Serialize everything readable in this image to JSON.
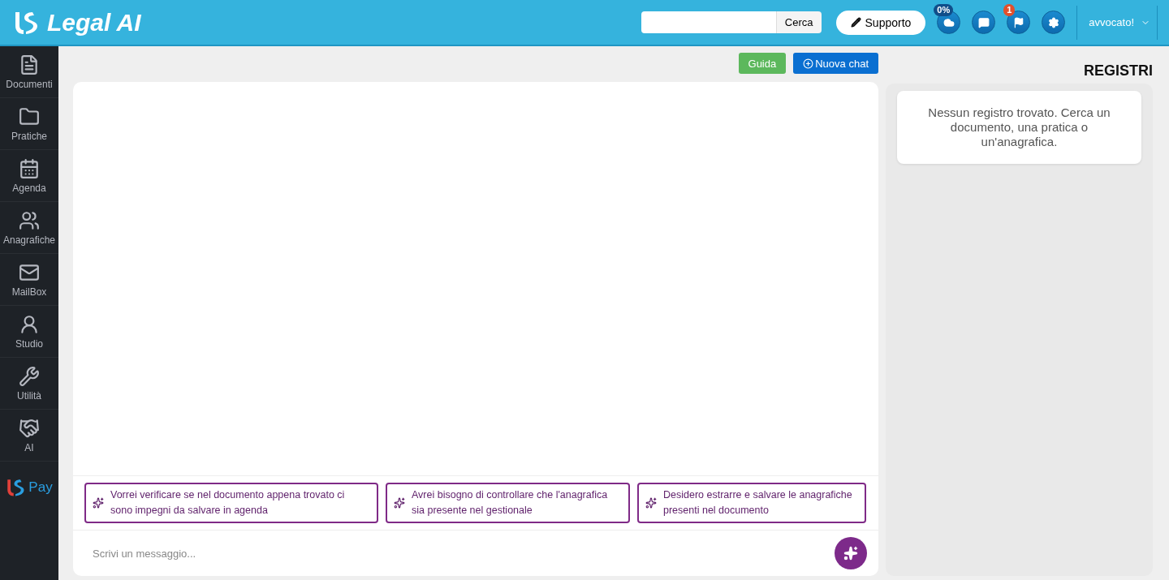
{
  "header": {
    "brand": "Legal AI",
    "search": {
      "button": "Cerca"
    },
    "support": "Supporto",
    "icons": [
      {
        "badge": "0%",
        "kind": "cloud"
      },
      {
        "kind": "chat"
      },
      {
        "badge": "1",
        "kind": "flag"
      },
      {
        "kind": "gear"
      }
    ],
    "user": "avvocato!"
  },
  "sidebar": {
    "items": [
      {
        "label": "Documenti"
      },
      {
        "label": "Pratiche"
      },
      {
        "label": "Agenda"
      },
      {
        "label": "Anagrafiche"
      },
      {
        "label": "MailBox"
      },
      {
        "label": "Studio"
      },
      {
        "label": "Utilità"
      },
      {
        "label": "AI"
      }
    ],
    "pay": "Pay"
  },
  "toolbar": {
    "guide": "Guida",
    "new_chat": "Nuova chat"
  },
  "chat": {
    "suggestions": [
      "Vorrei verificare se nel documento appena trovato ci sono impegni da salvare in agenda",
      "Avrei bisogno di controllare che l'anagrafica sia presente nel gestionale",
      "Desidero estrarre e salvare le anagrafiche presenti nel documento"
    ],
    "input": {
      "placeholder": "Scrivi un messaggio..."
    }
  },
  "registers": {
    "title": "REGISTRI",
    "empty": "Nessun registro trovato. Cerca un documento, una pratica o un'anagrafica."
  }
}
